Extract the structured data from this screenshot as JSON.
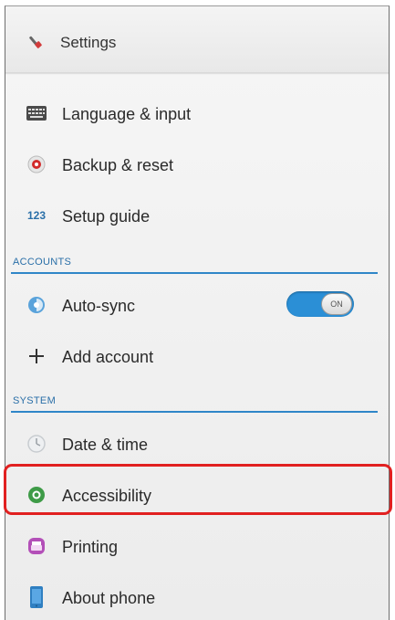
{
  "title_bar": {
    "title": "Settings",
    "icon": "settings-wrench-icon"
  },
  "device_items": [
    {
      "label": "Language & input",
      "icon": "keyboard-icon"
    },
    {
      "label": "Backup & reset",
      "icon": "backup-icon"
    },
    {
      "label": "Setup guide",
      "icon": "setup-guide-123-icon",
      "icon_text": "123"
    }
  ],
  "accounts_section": {
    "header": "ACCOUNTS",
    "auto_sync": {
      "label": "Auto-sync",
      "icon": "sync-icon",
      "toggle_state": "on",
      "toggle_label": "ON"
    },
    "add_account": {
      "label": "Add account",
      "icon": "plus-icon"
    }
  },
  "system_section": {
    "header": "SYSTEM",
    "items": [
      {
        "label": "Date & time",
        "icon": "clock-icon"
      },
      {
        "label": "Accessibility",
        "icon": "accessibility-icon",
        "highlighted": true
      },
      {
        "label": "Printing",
        "icon": "printer-icon"
      },
      {
        "label": "About phone",
        "icon": "phone-icon"
      }
    ]
  },
  "colors": {
    "accent": "#2f86c8",
    "highlight_border": "#e12020",
    "toggle_on": "#2b8fd6"
  }
}
